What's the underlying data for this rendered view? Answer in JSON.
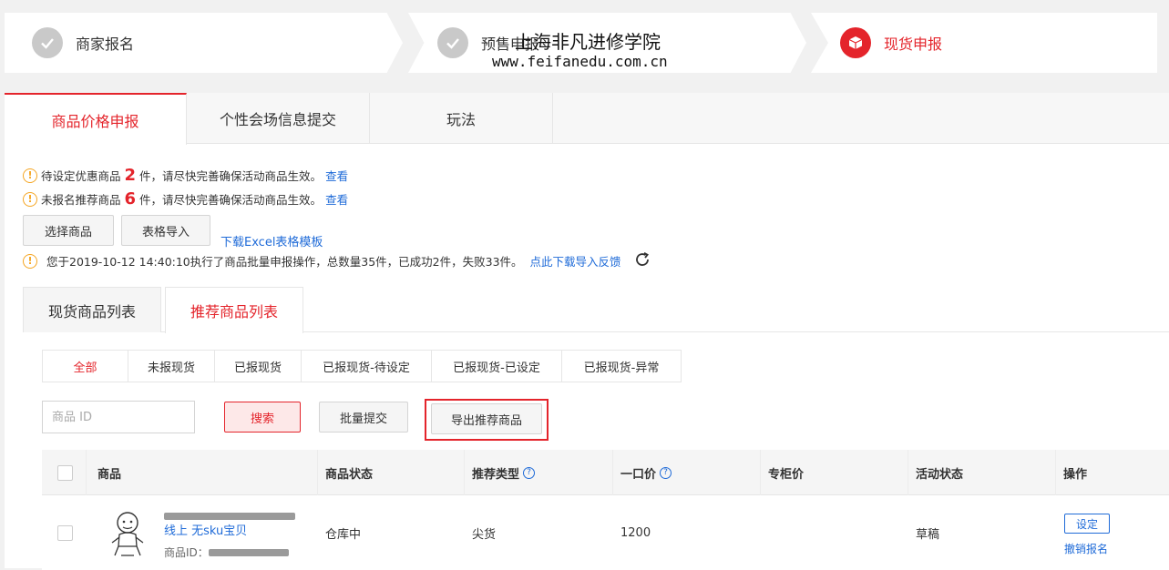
{
  "steps": [
    {
      "label": "商家报名",
      "state": "done"
    },
    {
      "label": "预售申报",
      "state": "done"
    },
    {
      "label": "现货申报",
      "state": "active"
    }
  ],
  "watermark": {
    "line1": "上海非凡进修学院",
    "line2": "www.feifanedu.com.cn"
  },
  "main_tabs": [
    "商品价格申报",
    "个性会场信息提交",
    "玩法"
  ],
  "notices": {
    "pending": {
      "prefix": "待设定优惠商品",
      "count": "2",
      "suffix": "件，请尽快完善确保活动商品生效。",
      "link": "查看"
    },
    "unregistered": {
      "prefix": "未报名推荐商品",
      "count": "6",
      "suffix": "件，请尽快完善确保活动商品生效。",
      "link": "查看"
    },
    "batch": {
      "text": "您于2019-10-12 14:40:10执行了商品批量申报操作，总数量35件，已成功2件，失败33件。",
      "link": "点此下载导入反馈"
    }
  },
  "buttons": {
    "select": "选择商品",
    "import": "表格导入",
    "download": "下载Excel表格模板",
    "search": "搜索",
    "batch_submit": "批量提交",
    "export": "导出推荐商品"
  },
  "sub_tabs": [
    "现货商品列表",
    "推荐商品列表"
  ],
  "filters": [
    "全部",
    "未报现货",
    "已报现货",
    "已报现货-待设定",
    "已报现货-已设定",
    "已报现货-异常"
  ],
  "search": {
    "placeholder": "商品 ID"
  },
  "table": {
    "headers": [
      "商品",
      "商品状态",
      "推荐类型",
      "一口价",
      "专柜价",
      "活动状态",
      "操作"
    ],
    "row": {
      "title_line2": "线上 无sku宝贝",
      "id_label": "商品ID：",
      "status": "仓库中",
      "type": "尖货",
      "price": "1200",
      "counter_price": "",
      "activity_status": "草稿",
      "action_set": "设定",
      "action_cancel": "撤销报名"
    }
  },
  "colors": {
    "accent": "#e4242b",
    "link": "#1f6bd8",
    "warn": "#f5a623"
  }
}
